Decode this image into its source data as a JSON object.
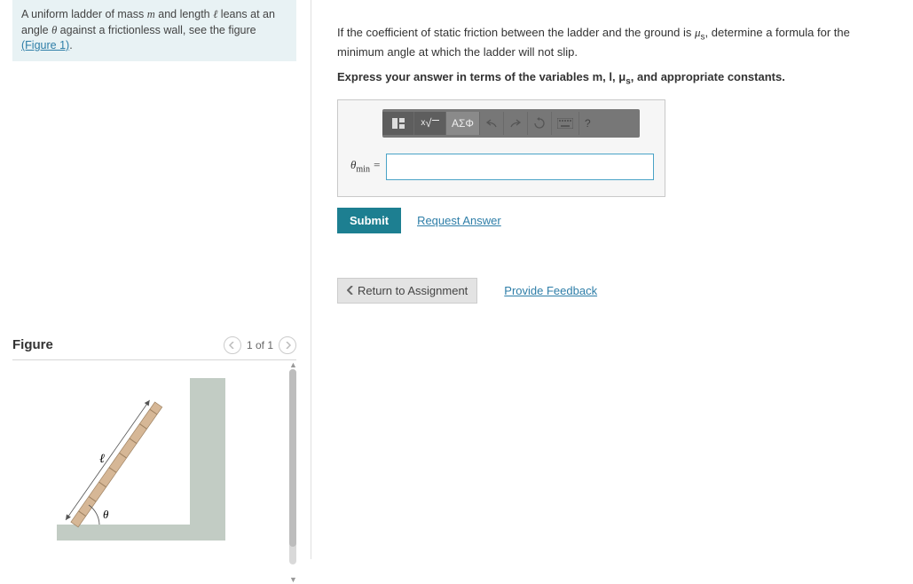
{
  "problem": {
    "text_prefix": "A uniform ladder of mass ",
    "var_m": "m",
    "text_mid1": " and length ",
    "var_l": "ℓ",
    "text_mid2": " leans at an angle ",
    "var_theta": "θ",
    "text_mid3": " against a frictionless wall, see the figure ",
    "figure_link": "(Figure 1)",
    "text_end": "."
  },
  "figure": {
    "title": "Figure",
    "pager": "1 of 1",
    "length_label": "ℓ",
    "angle_label": "θ"
  },
  "question": {
    "line1_a": "If the coefficient of static friction between the ladder and the ground is ",
    "mu": "μ",
    "mu_sub": "s",
    "line1_b": ", determine a formula for the minimum angle at which the ladder will not slip.",
    "instruct_a": "Express your answer in terms of the variables ",
    "v_m": "m",
    "v_l": "l",
    "v_mu": "μ",
    "v_mu_sub": "s",
    "instruct_b": ", and appropriate constants."
  },
  "toolbar": {
    "templates_icon_title": "templates",
    "math_sqrt": "x√",
    "greek": "ΑΣΦ",
    "undo": "undo",
    "redo": "redo",
    "reset": "reset",
    "keyboard": "keyboard",
    "help": "?"
  },
  "input": {
    "label_theta": "θ",
    "label_sub": "min",
    "equals": " = ",
    "value": ""
  },
  "actions": {
    "submit": "Submit",
    "request_answer": "Request Answer",
    "return": "Return to Assignment",
    "feedback": "Provide Feedback"
  }
}
